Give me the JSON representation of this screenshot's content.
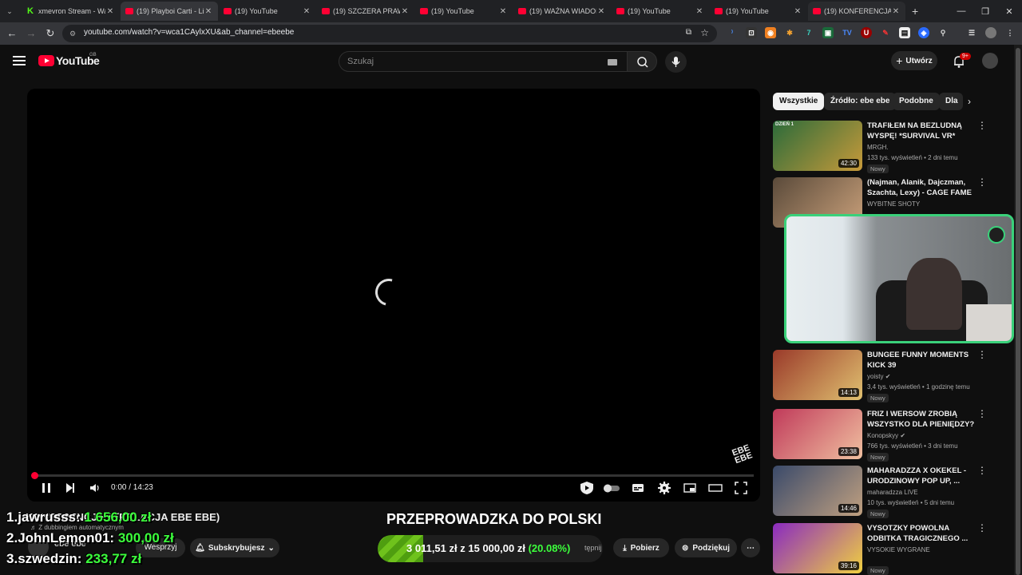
{
  "browser": {
    "tabs": [
      {
        "title": "xmevron Stream - Wa",
        "favicon": "kick-icon",
        "active": false
      },
      {
        "title": "(19) Playboi Carti - Li",
        "favicon": "youtube-icon",
        "active": true
      },
      {
        "title": "(19) YouTube",
        "favicon": "youtube-icon",
        "active": false
      },
      {
        "title": "(19) SZCZERA PRAWD",
        "favicon": "youtube-icon",
        "active": false
      },
      {
        "title": "(19) YouTube",
        "favicon": "youtube-icon",
        "active": false
      },
      {
        "title": "(19) WAŻNA WIADOM",
        "favicon": "youtube-icon",
        "active": false
      },
      {
        "title": "(19) YouTube",
        "favicon": "youtube-icon",
        "active": false
      },
      {
        "title": "(19) YouTube",
        "favicon": "youtube-icon",
        "active": false
      },
      {
        "title": "(19) KONFERENCJA E",
        "favicon": "youtube-icon",
        "active": false
      }
    ],
    "url": "youtube.com/watch?v=wca1CAylxXU&ab_channel=ebeebe"
  },
  "youtube": {
    "logo_text": "YouTube",
    "country_code": "GB",
    "search_placeholder": "Szukaj",
    "create_label": "Utwórz",
    "notif_count": "9+"
  },
  "player": {
    "time": "0:00 / 14:23",
    "progress": 0,
    "watermark": "EBE EBE"
  },
  "video": {
    "title": "KONFERENCJA 1 (RELACJA EBE EBE)",
    "dubbing_note": "Z dubbingiem automatycznym",
    "channel": "ebe ebe",
    "support_label": "Wesprzyj",
    "subscribe_label": "Subskrybujesz",
    "share_fragment": "tępnij",
    "download_label": "Pobierz",
    "thanks_label": "Podziękuj"
  },
  "overlay": {
    "leaderboard": [
      {
        "rank": "1.",
        "name": "jawrusss:",
        "amount": "1 656,00 zł"
      },
      {
        "rank": "2.",
        "name": "JohnLemon01:",
        "amount": "300,00 zł"
      },
      {
        "rank": "3.",
        "name": "szwedzin:",
        "amount": "233,77 zł"
      }
    ],
    "goal_title": "PRZEPROWADZKA DO POLSKI",
    "goal_current": "3 011,51 zł",
    "goal_sep": "z",
    "goal_target": "15 000,00 zł",
    "goal_pct": "(20.08%)",
    "goal_fraction": 0.2008
  },
  "chips": [
    "Wszystkie",
    "Źródło: ebe ebe",
    "Podobne",
    "Dla"
  ],
  "recommendations": [
    {
      "title": "TRAFIŁEM NA BEZLUDNĄ WYSPĘ! *SURVIVAL VR*",
      "channel": "MRGH.",
      "meta": "133 tys. wyświetleń • 2 dni temu",
      "badge": "Nowy",
      "duration": "42:30",
      "thumb_colors": [
        "#2b6b3a",
        "#c79a3a"
      ]
    },
    {
      "title": "(Najman, Alanik, Dajczman, Szachta, Lexy) - CAGE FAME 2...",
      "channel": "WYBITNE SHOTY",
      "meta": "",
      "badge": "",
      "duration": "",
      "thumb_colors": [
        "#5a4a3a",
        "#c9a07a"
      ]
    },
    {
      "title": "BUNGEE FUNNY MOMENTS KICK 39",
      "channel": "yoisty",
      "meta": "3,4 tys. wyświetleń • 1 godzinę temu",
      "badge": "Nowy",
      "duration": "14:13",
      "thumb_colors": [
        "#9a3a2a",
        "#e0c070"
      ]
    },
    {
      "title": "FRIZ I WERSOW ZROBIĄ WSZYSTKO DLA PIENIĘDZY? ...",
      "channel": "Konopskyy",
      "meta": "766 tys. wyświetleń • 3 dni temu",
      "badge": "Nowy",
      "duration": "23:38",
      "thumb_colors": [
        "#c03a5a",
        "#f0c0a0"
      ]
    },
    {
      "title": "MAHARADZZA X OKEKEL - URODZINOWY POP UP, ...",
      "channel": "maharadzza LIVE",
      "meta": "10 tys. wyświetleń • 5 dni temu",
      "badge": "Nowy",
      "duration": "14:46",
      "thumb_colors": [
        "#3a4a6a",
        "#c0a080"
      ]
    },
    {
      "title": "VYSOTZKY POWOLNA ODBITKA TRAGICZNEGO ...",
      "channel": "VYSOKIE WYGRANE",
      "meta": "",
      "badge": "Nowy",
      "duration": "39:16",
      "thumb_colors": [
        "#8a2ac0",
        "#f0d040"
      ]
    }
  ]
}
